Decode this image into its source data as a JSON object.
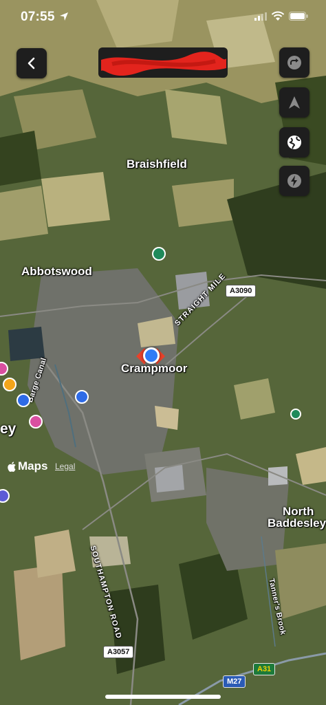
{
  "status_bar": {
    "time": "07:55"
  },
  "map": {
    "places": {
      "braishfield": "Braishfield",
      "abbotswood": "Abbotswood",
      "crampmoor": "Crampmoor",
      "north": "North",
      "baddesley": "Baddesley",
      "romsey_partial": "ey"
    },
    "roads": {
      "straight_mile": "STRAIGHT MILE",
      "barge_canal": "Barge Canal",
      "southampton_road": "SOUTHAMPTON ROAD",
      "tanners_brook": "Tanner's Brook"
    },
    "shields": {
      "a3090": "A3090",
      "a3057": "A3057",
      "a31": "A31",
      "m27": "M27"
    }
  },
  "attribution": {
    "brand": "Maps",
    "legal": "Legal"
  },
  "icons": {
    "back": "chevron-left-icon",
    "share_route": "redo-arrow-icon",
    "navigate": "navigation-arrow-icon",
    "globe": "globe-icon",
    "flash": "lightning-icon"
  },
  "colors": {
    "user_location": "#2f7cf6",
    "destination": "#e8412a",
    "button_bg": "#1e1e1e"
  }
}
